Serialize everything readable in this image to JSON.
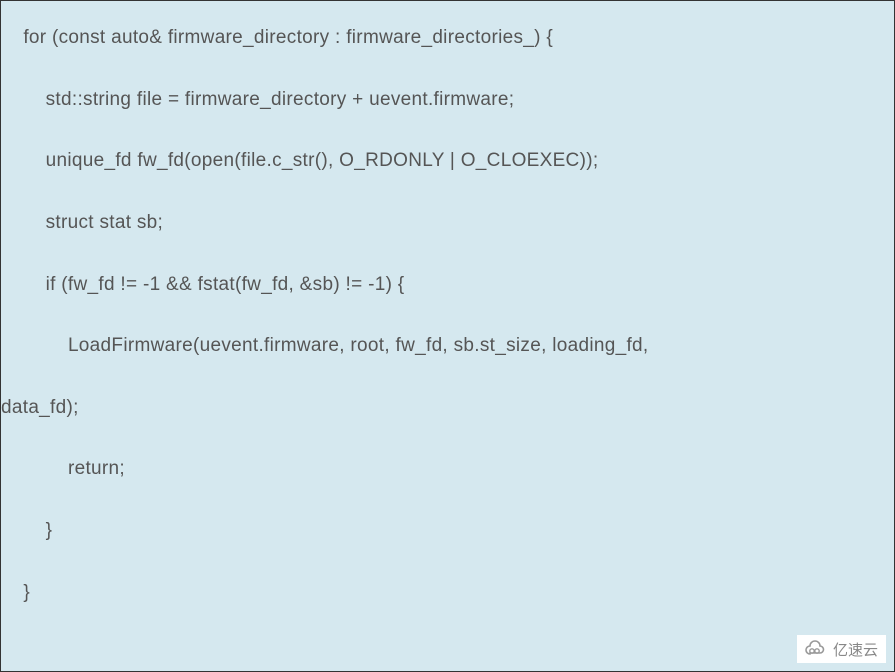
{
  "code": {
    "lines": [
      "    for (const auto& firmware_directory : firmware_directories_) {",
      "        std::string file = firmware_directory + uevent.firmware;",
      "        unique_fd fw_fd(open(file.c_str(), O_RDONLY | O_CLOEXEC));",
      "        struct stat sb;",
      "        if (fw_fd != -1 && fstat(fw_fd, &sb) != -1) {",
      "            LoadFirmware(uevent.firmware, root, fw_fd, sb.st_size, loading_fd,",
      "data_fd);",
      "            return;",
      "        }",
      "    }"
    ]
  },
  "watermark": {
    "text": "亿速云"
  }
}
